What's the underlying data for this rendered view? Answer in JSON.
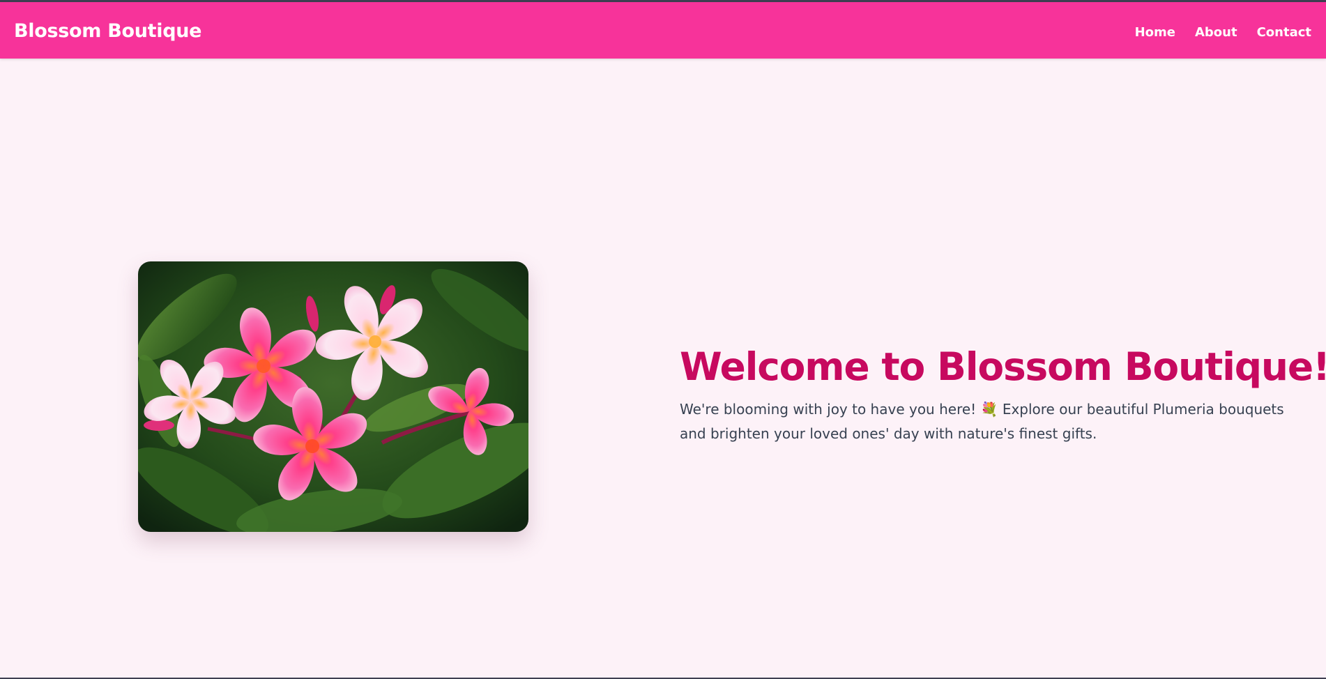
{
  "navbar": {
    "brand": "Blossom Boutique",
    "links": [
      {
        "label": "Home"
      },
      {
        "label": "About"
      },
      {
        "label": "Contact"
      }
    ]
  },
  "hero": {
    "title": "Welcome to Blossom Boutique!",
    "description_part1": "We're blooming with joy to have you here!",
    "emoji": "💐",
    "description_part2": "Explore our beautiful Plumeria bouquets and brighten your loved ones' day with nature's finest gifts.",
    "image_icon": "plumeria-flower-photo"
  },
  "colors": {
    "navbar_bg": "#f7339a",
    "page_bg": "#fdf2f8",
    "title": "#c7095f",
    "body_text": "#374151"
  }
}
